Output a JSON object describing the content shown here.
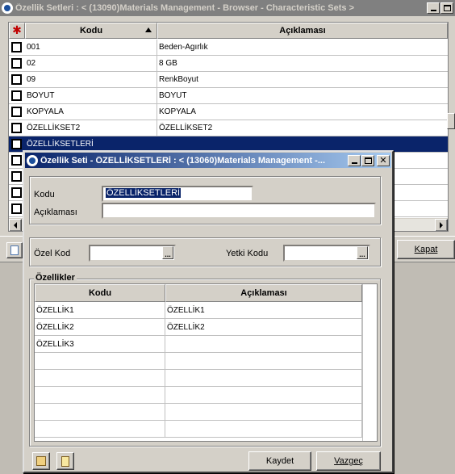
{
  "browser": {
    "title": "Özellik Setleri : < (13090)Materials Management - Browser - Characteristic Sets >",
    "columns": {
      "code": "Kodu",
      "description": "Açıklaması"
    },
    "rows": [
      {
        "code": "001",
        "description": "Beden-Agırlık"
      },
      {
        "code": "02",
        "description": "8 GB"
      },
      {
        "code": "09",
        "description": "RenkBoyut"
      },
      {
        "code": "BOYUT",
        "description": "BOYUT"
      },
      {
        "code": "KOPYALA",
        "description": "KOPYALA"
      },
      {
        "code": "ÖZELLİKSET2",
        "description": "ÖZELLİKSET2"
      },
      {
        "code": "ÖZELLİKSETLERİ",
        "description": ""
      }
    ],
    "close_label": "Kapat",
    "colors": {
      "selection": "#0a246a",
      "inactive_title": "#808080"
    }
  },
  "dialog": {
    "title": "Özellik Seti - ÖZELLİKSETLERİ : < (13060)Materials Management -...",
    "code_label": "Kodu",
    "code_value": "ÖZELLİKSETLERİ",
    "description_label": "Açıklaması",
    "description_value": "",
    "special_code_label": "Özel Kod",
    "special_code_value": "",
    "auth_code_label": "Yetki Kodu",
    "auth_code_value": "",
    "lookup_label": "...",
    "properties_group": "Özellikler",
    "grid_columns": {
      "code": "Kodu",
      "description": "Açıklaması"
    },
    "grid_rows": [
      {
        "code": "ÖZELLİK1",
        "description": "ÖZELLİK1"
      },
      {
        "code": "ÖZELLİK2",
        "description": "ÖZELLİK2"
      },
      {
        "code": "ÖZELLİK3",
        "description": ""
      }
    ],
    "save_label": "Kaydet",
    "cancel_label": "Vazgeç",
    "colors": {
      "title_start": "#0a246a",
      "title_end": "#a6caf0"
    }
  }
}
